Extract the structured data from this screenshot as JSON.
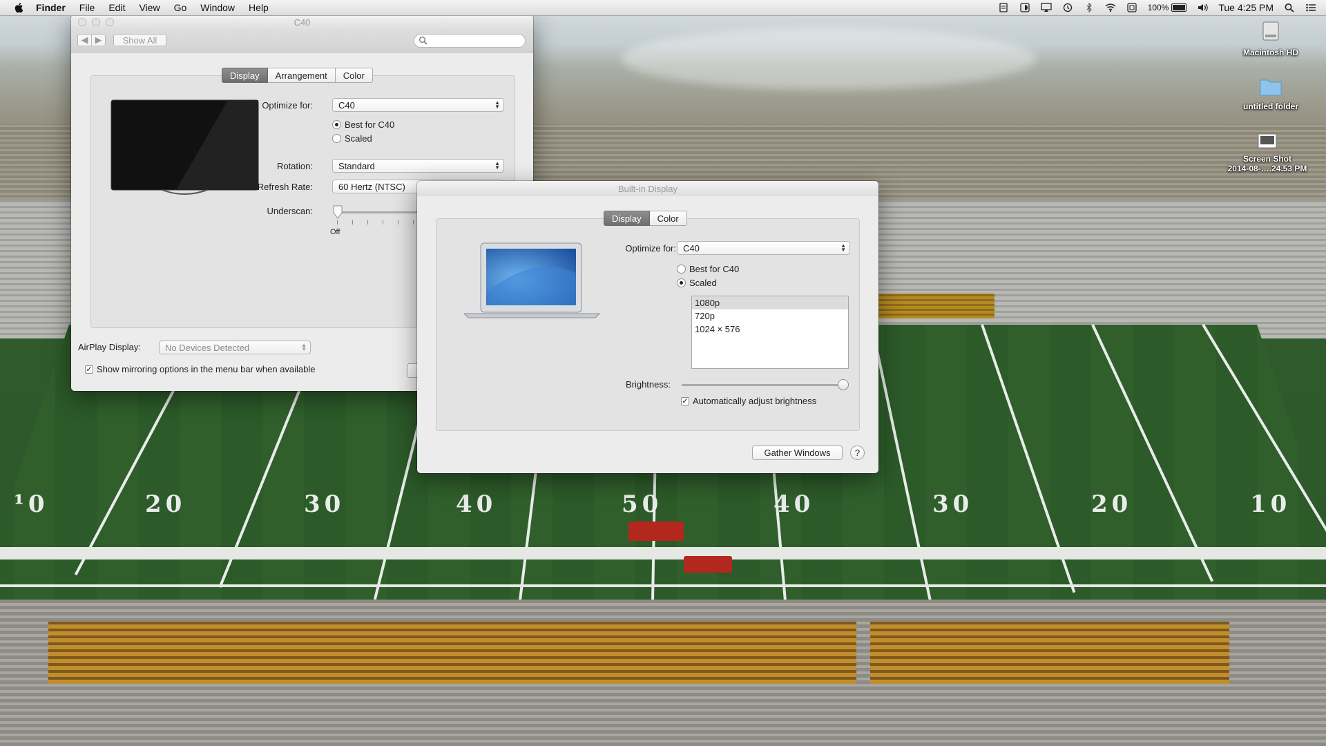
{
  "menubar": {
    "app": "Finder",
    "items": [
      "File",
      "Edit",
      "View",
      "Go",
      "Window",
      "Help"
    ],
    "battery": "100%",
    "clock": "Tue 4:25 PM"
  },
  "desktop_icons": {
    "hd": "Macintosh HD",
    "folder": "untitled folder",
    "screenshot_line1": "Screen Shot",
    "screenshot_line2": "2014-08-….24.53 PM"
  },
  "c40_window": {
    "title": "C40",
    "show_all": "Show All",
    "tabs": [
      "Display",
      "Arrangement",
      "Color"
    ],
    "optimize_label": "Optimize for:",
    "optimize_value": "C40",
    "radio_best": "Best for C40",
    "radio_scaled": "Scaled",
    "rotation_label": "Rotation:",
    "rotation_value": "Standard",
    "refresh_label": "Refresh Rate:",
    "refresh_value": "60 Hertz (NTSC)",
    "underscan_label": "Underscan:",
    "underscan_off": "Off",
    "airplay_label": "AirPlay Display:",
    "airplay_value": "No Devices Detected",
    "mirroring_check": "Show mirroring options in the menu bar when available"
  },
  "builtin_window": {
    "title": "Built-in Display",
    "tabs": [
      "Display",
      "Color"
    ],
    "optimize_label": "Optimize for:",
    "optimize_value": "C40",
    "radio_best": "Best for C40",
    "radio_scaled": "Scaled",
    "resolutions": [
      "1080p",
      "720p",
      "1024 × 576"
    ],
    "brightness_label": "Brightness:",
    "brightness_level": 1.0,
    "auto_brightness": "Automatically adjust brightness",
    "gather_windows": "Gather Windows",
    "help": "?"
  },
  "colors": {
    "tab_active": "#7a7a7a",
    "window_bg": "#ececec",
    "field_green": "#2c5a29"
  }
}
